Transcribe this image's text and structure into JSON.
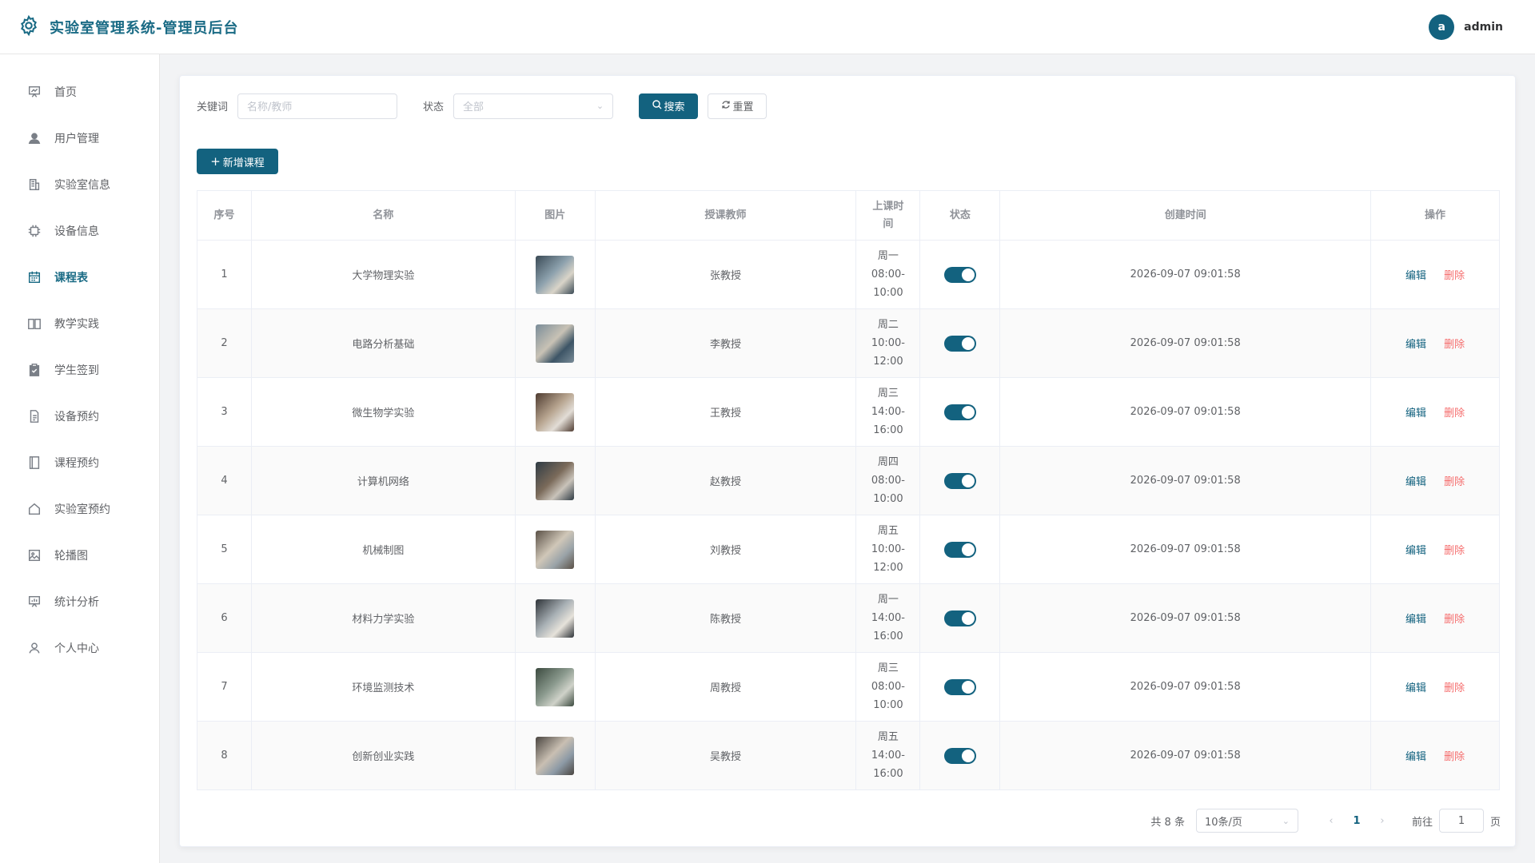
{
  "header": {
    "title": "实验室管理系统-管理员后台",
    "avatar_letter": "a",
    "username": "admin"
  },
  "sidebar": {
    "items": [
      {
        "label": "首页",
        "icon": "dashboard-icon"
      },
      {
        "label": "用户管理",
        "icon": "user-icon"
      },
      {
        "label": "实验室信息",
        "icon": "building-icon"
      },
      {
        "label": "设备信息",
        "icon": "cpu-icon"
      },
      {
        "label": "课程表",
        "icon": "calendar-icon",
        "active": true
      },
      {
        "label": "教学实践",
        "icon": "book-icon"
      },
      {
        "label": "学生签到",
        "icon": "clipboard-check-icon"
      },
      {
        "label": "设备预约",
        "icon": "document-icon"
      },
      {
        "label": "课程预约",
        "icon": "notebook-icon"
      },
      {
        "label": "实验室预约",
        "icon": "house-icon"
      },
      {
        "label": "轮播图",
        "icon": "picture-icon"
      },
      {
        "label": "统计分析",
        "icon": "chart-board-icon"
      },
      {
        "label": "个人中心",
        "icon": "person-icon"
      }
    ]
  },
  "filters": {
    "keyword_label": "关键词",
    "keyword_placeholder": "名称/教师",
    "status_label": "状态",
    "status_value": "全部",
    "search_label": "搜索",
    "reset_label": "重置"
  },
  "add_button": "新增课程",
  "table": {
    "headers": [
      "序号",
      "名称",
      "图片",
      "授课教师",
      "上课时间",
      "状态",
      "创建时间",
      "操作"
    ],
    "edit_label": "编辑",
    "delete_label": "删除",
    "rows": [
      {
        "no": "1",
        "name": "大学物理实验",
        "teacher": "张教授",
        "day": "周一",
        "start": "08:00-",
        "end": "10:00",
        "created": "2026-09-07 09:01:58"
      },
      {
        "no": "2",
        "name": "电路分析基础",
        "teacher": "李教授",
        "day": "周二",
        "start": "10:00-",
        "end": "12:00",
        "created": "2026-09-07 09:01:58"
      },
      {
        "no": "3",
        "name": "微生物学实验",
        "teacher": "王教授",
        "day": "周三",
        "start": "14:00-",
        "end": "16:00",
        "created": "2026-09-07 09:01:58"
      },
      {
        "no": "4",
        "name": "计算机网络",
        "teacher": "赵教授",
        "day": "周四",
        "start": "08:00-",
        "end": "10:00",
        "created": "2026-09-07 09:01:58"
      },
      {
        "no": "5",
        "name": "机械制图",
        "teacher": "刘教授",
        "day": "周五",
        "start": "10:00-",
        "end": "12:00",
        "created": "2026-09-07 09:01:58"
      },
      {
        "no": "6",
        "name": "材料力学实验",
        "teacher": "陈教授",
        "day": "周一",
        "start": "14:00-",
        "end": "16:00",
        "created": "2026-09-07 09:01:58"
      },
      {
        "no": "7",
        "name": "环境监测技术",
        "teacher": "周教授",
        "day": "周三",
        "start": "08:00-",
        "end": "10:00",
        "created": "2026-09-07 09:01:58"
      },
      {
        "no": "8",
        "name": "创新创业实践",
        "teacher": "吴教授",
        "day": "周五",
        "start": "14:00-",
        "end": "16:00",
        "created": "2026-09-07 09:01:58"
      }
    ]
  },
  "pagination": {
    "total": "共 8 条",
    "page_size": "10条/页",
    "current_page": "1",
    "goto_label": "前往",
    "goto_value": "1",
    "page_suffix": "页"
  },
  "colors": {
    "accent": "#13627f",
    "danger": "#f56c6c"
  }
}
